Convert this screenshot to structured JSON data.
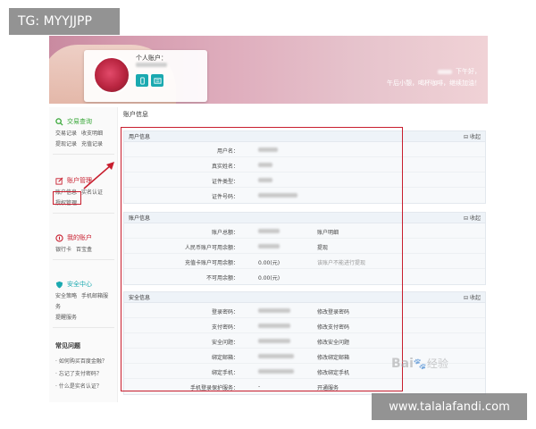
{
  "overlay": {
    "top_left_tag": "TG: MYYJJPP",
    "bottom_right_tag": "www.talalafandi.com",
    "watermark_brand": "Bai",
    "watermark_suffix": "经验"
  },
  "banner": {
    "account_label": "个人账户：",
    "greeting_line1": "下午好，",
    "greeting_line2": "午后小憩，喝杯咖啡，继续加油！"
  },
  "sidebar": {
    "groups": [
      {
        "title": "交易查询",
        "icon": "search-icon",
        "color": "#3aa83a",
        "links": [
          "交易记录",
          "收支明细",
          "提现记录",
          "充值记录"
        ]
      },
      {
        "title": "账户管理",
        "icon": "edit-icon",
        "color": "#c81e2e",
        "links": [
          "账户信息",
          "实名认证",
          "授权管理"
        ]
      },
      {
        "title": "我的账户",
        "icon": "coin-icon",
        "color": "#c81e2e",
        "links": [
          "银行卡",
          "百宝盒"
        ]
      },
      {
        "title": "安全中心",
        "icon": "shield-icon",
        "color": "#1aa9b0",
        "links": [
          "安全策略",
          "手机邮箱服务",
          "提醒服务"
        ]
      }
    ],
    "faq_title": "常见问题",
    "faq_items": [
      "· 如何购买百度金融？",
      "· 忘记了支付密码？",
      "· 什么是实名认证？"
    ]
  },
  "main": {
    "title": "账户信息",
    "collapse_label": "收起",
    "sections": [
      {
        "header": "用户信息",
        "rows": [
          {
            "label": "用户名：",
            "value": "",
            "action": ""
          },
          {
            "label": "真实姓名：",
            "value": "",
            "action": ""
          },
          {
            "label": "证件类型：",
            "value": "",
            "action": ""
          },
          {
            "label": "证件号码：",
            "value": "",
            "action": ""
          }
        ]
      },
      {
        "header": "账户信息",
        "rows": [
          {
            "label": "账户总额：",
            "value": "",
            "action": "账户明细"
          },
          {
            "label": "人民币账户可用余额：",
            "value": "",
            "action": "提现"
          },
          {
            "label": "充值卡账户可用余额：",
            "value": "0.00(元)",
            "action": "该账户不能进行提现"
          },
          {
            "label": "不可用余额：",
            "value": "0.00(元)",
            "action": ""
          }
        ]
      },
      {
        "header": "安全信息",
        "rows": [
          {
            "label": "登录密码：",
            "value": "",
            "action": "修改登录密码"
          },
          {
            "label": "支付密码：",
            "value": "",
            "action": "修改支付密码"
          },
          {
            "label": "安全问题：",
            "value": "",
            "action": "修改安全问题"
          },
          {
            "label": "绑定邮箱：",
            "value": "",
            "action": "修改绑定邮箱"
          },
          {
            "label": "绑定手机：",
            "value": "",
            "action": "修改绑定手机"
          },
          {
            "label": "手机登录保护服务：",
            "value": "-",
            "action": "开通服务"
          }
        ]
      }
    ]
  }
}
